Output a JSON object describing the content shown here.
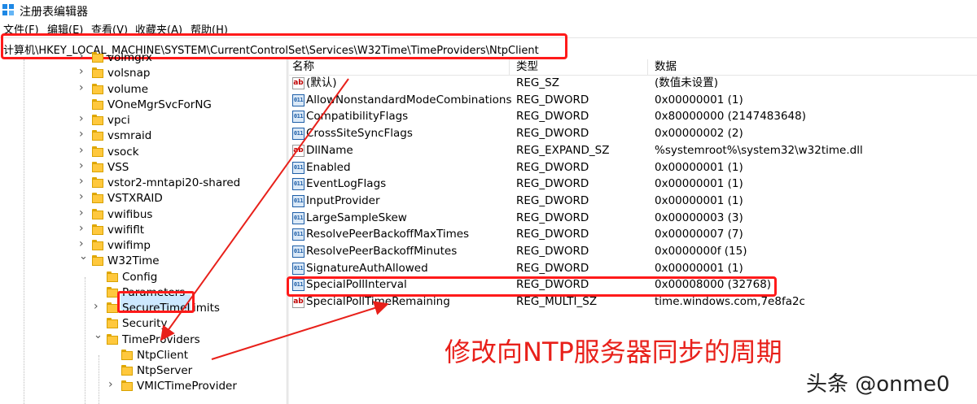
{
  "window": {
    "title": "注册表编辑器"
  },
  "menu": [
    "文件(F)",
    "编辑(E)",
    "查看(V)",
    "收藏夹(A)",
    "帮助(H)"
  ],
  "address": "计算机\\HKEY_LOCAL_MACHINE\\SYSTEM\\CurrentControlSet\\Services\\W32Time\\TimeProviders\\NtpClient",
  "tree": {
    "items": [
      {
        "label": "volmgrx",
        "expander": "collapsed"
      },
      {
        "label": "volsnap",
        "expander": "collapsed"
      },
      {
        "label": "volume",
        "expander": "collapsed"
      },
      {
        "label": "VOneMgrSvcForNG",
        "expander": "none"
      },
      {
        "label": "vpci",
        "expander": "collapsed"
      },
      {
        "label": "vsmraid",
        "expander": "collapsed"
      },
      {
        "label": "vsock",
        "expander": "collapsed"
      },
      {
        "label": "VSS",
        "expander": "collapsed"
      },
      {
        "label": "vstor2-mntapi20-shared",
        "expander": "collapsed"
      },
      {
        "label": "VSTXRAID",
        "expander": "collapsed"
      },
      {
        "label": "vwifibus",
        "expander": "collapsed"
      },
      {
        "label": "vwififlt",
        "expander": "collapsed"
      },
      {
        "label": "vwifimp",
        "expander": "collapsed"
      },
      {
        "label": "W32Time",
        "expander": "expanded"
      },
      {
        "label": "Config",
        "expander": "none"
      },
      {
        "label": "Parameters",
        "expander": "none"
      },
      {
        "label": "SecureTimeLimits",
        "expander": "collapsed"
      },
      {
        "label": "Security",
        "expander": "none"
      },
      {
        "label": "TimeProviders",
        "expander": "expanded"
      },
      {
        "label": "NtpClient",
        "expander": "none",
        "selected": true
      },
      {
        "label": "NtpServer",
        "expander": "none"
      },
      {
        "label": "VMICTimeProvider",
        "expander": "collapsed"
      }
    ]
  },
  "list": {
    "headers": {
      "name": "名称",
      "type": "类型",
      "data": "数据"
    },
    "rows": [
      {
        "icon": "string-value-icon",
        "name": "(默认)",
        "type": "REG_SZ",
        "data": "(数值未设置)"
      },
      {
        "icon": "binary-value-icon",
        "name": "AllowNonstandardModeCombinations",
        "type": "REG_DWORD",
        "data": "0x00000001 (1)"
      },
      {
        "icon": "binary-value-icon",
        "name": "CompatibilityFlags",
        "type": "REG_DWORD",
        "data": "0x80000000 (2147483648)"
      },
      {
        "icon": "binary-value-icon",
        "name": "CrossSiteSyncFlags",
        "type": "REG_DWORD",
        "data": "0x00000002 (2)"
      },
      {
        "icon": "string-value-icon",
        "name": "DllName",
        "type": "REG_EXPAND_SZ",
        "data": "%systemroot%\\system32\\w32time.dll"
      },
      {
        "icon": "binary-value-icon",
        "name": "Enabled",
        "type": "REG_DWORD",
        "data": "0x00000001 (1)"
      },
      {
        "icon": "binary-value-icon",
        "name": "EventLogFlags",
        "type": "REG_DWORD",
        "data": "0x00000001 (1)"
      },
      {
        "icon": "binary-value-icon",
        "name": "InputProvider",
        "type": "REG_DWORD",
        "data": "0x00000001 (1)"
      },
      {
        "icon": "binary-value-icon",
        "name": "LargeSampleSkew",
        "type": "REG_DWORD",
        "data": "0x00000003 (3)"
      },
      {
        "icon": "binary-value-icon",
        "name": "ResolvePeerBackoffMaxTimes",
        "type": "REG_DWORD",
        "data": "0x00000007 (7)"
      },
      {
        "icon": "binary-value-icon",
        "name": "ResolvePeerBackoffMinutes",
        "type": "REG_DWORD",
        "data": "0x0000000f (15)"
      },
      {
        "icon": "binary-value-icon",
        "name": "SignatureAuthAllowed",
        "type": "REG_DWORD",
        "data": "0x00000001 (1)"
      },
      {
        "icon": "binary-value-icon",
        "name": "SpecialPollInterval",
        "type": "REG_DWORD",
        "data": "0x00008000 (32768)"
      },
      {
        "icon": "string-value-icon",
        "name": "SpecialPollTimeRemaining",
        "type": "REG_MULTI_SZ",
        "data": "time.windows.com,7e8fa2c"
      }
    ]
  },
  "annotation": "修改向NTP服务器同步的周期",
  "watermark": "头条 @onme0",
  "colors": {
    "highlight": "#ff1a1a",
    "selection": "#cce8ff",
    "folder": "#ffc83d"
  }
}
